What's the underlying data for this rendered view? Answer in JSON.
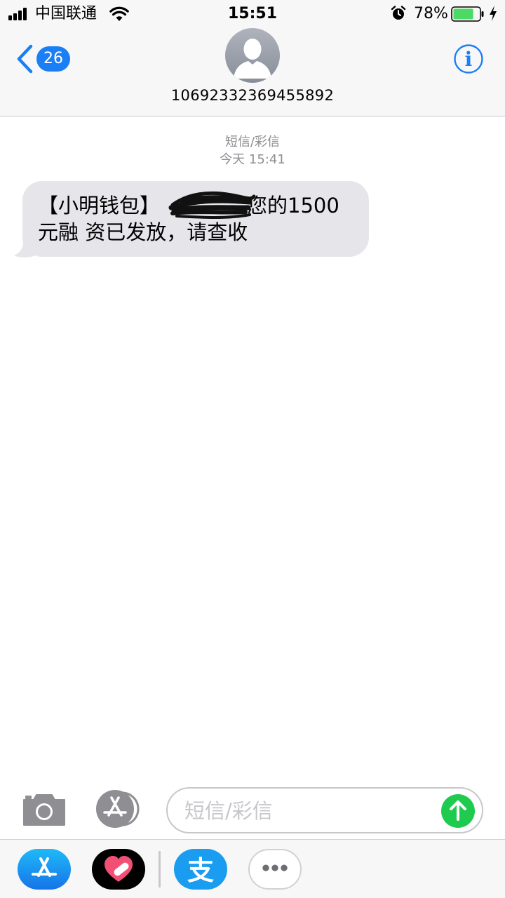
{
  "status_bar": {
    "carrier": "中国联通",
    "time": "15:51",
    "battery_percent": "78%",
    "battery_level": 0.78,
    "icons": [
      "signal-icon",
      "wifi-icon",
      "alarm-icon",
      "battery-icon",
      "charging-icon"
    ]
  },
  "header": {
    "back_badge": "26",
    "sender": "10692332369455892",
    "icons": [
      "back-chevron-icon",
      "contact-avatar-icon",
      "info-icon"
    ]
  },
  "conversation": {
    "service_label": "短信/彩信",
    "timestamp": "今天 15:41",
    "messages": [
      {
        "direction": "incoming",
        "text": "【小明钱包】 您的1500 元融 资已发放，请查收",
        "line1_prefix": "【小明钱包】",
        "line1_suffix": "您的1500",
        "line2": "元融 资已发放，请查收",
        "redacted": true
      }
    ]
  },
  "input_bar": {
    "placeholder": "短信/彩信",
    "icons": [
      "camera-icon",
      "app-store-icon",
      "send-arrow-icon"
    ]
  },
  "app_drawer": {
    "apps": [
      "app-store-icon",
      "digital-touch-heart-icon",
      "alipay-icon",
      "more-icon"
    ],
    "alipay_glyph": "支"
  },
  "colors": {
    "accent": "#1a7ff5",
    "bubble": "#e5e5ea",
    "send": "#1fcb4f",
    "meta_text": "#8e8e93"
  }
}
